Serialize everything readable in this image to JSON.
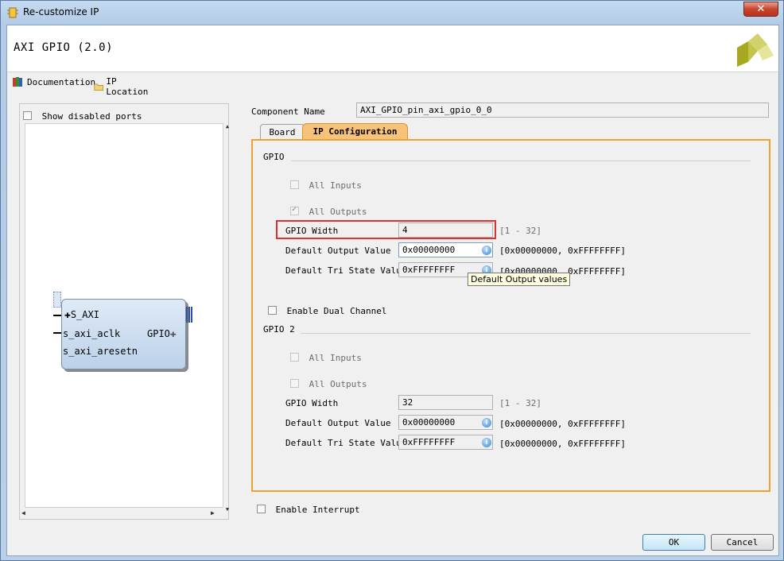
{
  "window": {
    "title": "Re-customize IP",
    "close_glyph": "✕"
  },
  "header": {
    "ip_title": "AXI GPIO (2.0)",
    "logo_icon": "xilinx-logo-icon"
  },
  "toolbar": {
    "documentation": "Documentation",
    "ip_location": "IP Location"
  },
  "left_panel": {
    "show_disabled_ports": "Show disabled ports",
    "block": {
      "s_axi": "S_AXI",
      "aclk": "s_axi_aclk",
      "aresetn": "s_axi_aresetn",
      "gpio": "GPIO"
    }
  },
  "component": {
    "label": "Component Name",
    "value": "AXI_GPIO_pin_axi_gpio_0_0"
  },
  "tabs": [
    {
      "label": "Board"
    },
    {
      "label": "IP Configuration"
    }
  ],
  "gpio": {
    "title": "GPIO",
    "all_inputs": "All Inputs",
    "all_outputs": "All Outputs",
    "width_label": "GPIO Width",
    "width_value": "4",
    "width_range": "[1 - 32]",
    "default_output_label": "Default Output Value",
    "default_output_value": "0x00000000",
    "default_output_range": "[0x00000000, 0xFFFFFFFF]",
    "tri_state_label": "Default Tri State Value",
    "tri_state_value": "0xFFFFFFFF",
    "tri_state_range": "[0x00000000, 0xFFFFFFFF]",
    "tooltip": "Default Output values"
  },
  "dual_channel": {
    "label": "Enable Dual Channel"
  },
  "gpio2": {
    "title": "GPIO 2",
    "all_inputs": "All Inputs",
    "all_outputs": "All Outputs",
    "width_label": "GPIO Width",
    "width_value": "32",
    "width_range": "[1 - 32]",
    "default_output_label": "Default Output Value",
    "default_output_value": "0x00000000",
    "default_output_range": "[0x00000000, 0xFFFFFFFF]",
    "tri_state_label": "Default Tri State Value",
    "tri_state_value": "0xFFFFFFFF",
    "tri_state_range": "[0x00000000, 0xFFFFFFFF]"
  },
  "interrupt": {
    "label": "Enable Interrupt"
  },
  "buttons": {
    "ok": "OK",
    "cancel": "Cancel"
  },
  "colors": {
    "accent_orange": "#f0a030",
    "highlight_red": "#e03030",
    "window_frame": "#b9d0ea"
  }
}
